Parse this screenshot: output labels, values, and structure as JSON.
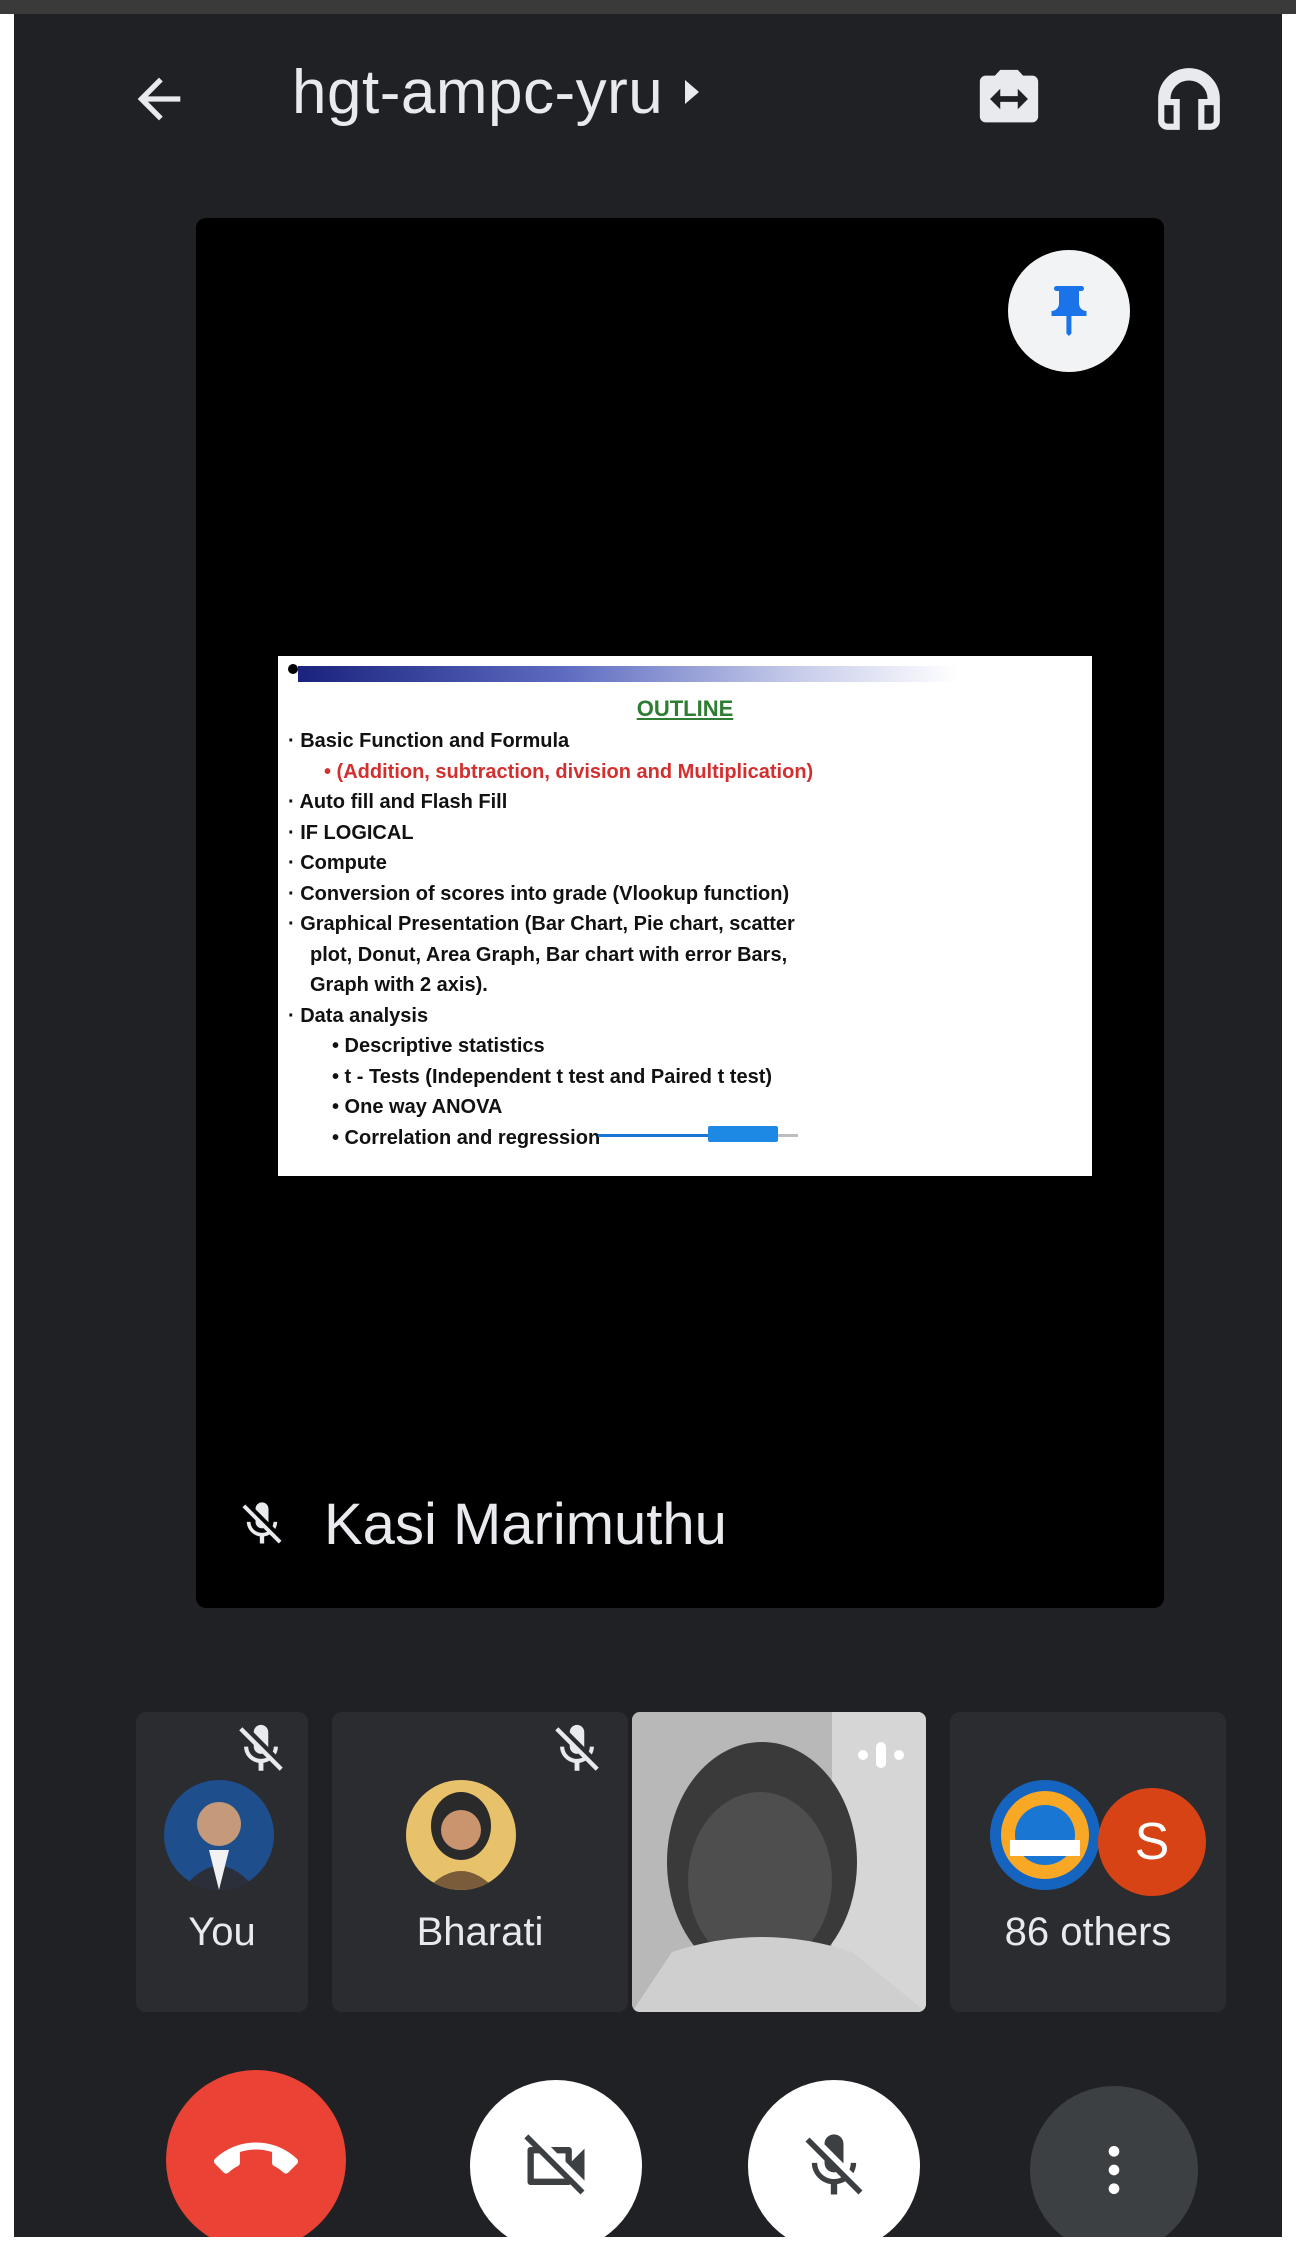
{
  "header": {
    "meeting_code": "hgt-ampc-yru",
    "back_icon": "arrow-left-icon",
    "switch_camera_icon": "camera-switch-icon",
    "audio_icon": "headphones-icon"
  },
  "main_tile": {
    "pin_icon": "pin-icon",
    "speaker_name": "Kasi Marimuthu",
    "speaker_muted_icon": "mic-off-icon",
    "slide": {
      "title": "OUTLINE",
      "lines": [
        "· Basic Function and Formula",
        "• (Addition, subtraction, division and Multiplication)",
        "· Auto fill and Flash Fill",
        "· IF LOGICAL",
        "· Compute",
        "· Conversion of scores into grade (Vlookup function)",
        "· Graphical Presentation (Bar Chart, Pie chart, scatter",
        "plot, Donut, Area Graph, Bar chart with error Bars,",
        "Graph with 2 axis).",
        "· Data analysis",
        "• Descriptive statistics",
        "• t - Tests (Independent t test and Paired t test)",
        "• One way ANOVA",
        "• Correlation and regression"
      ]
    }
  },
  "participants": [
    {
      "name": "You",
      "muted": true
    },
    {
      "name": "Bharati",
      "muted": true
    },
    {
      "name": "",
      "video": true
    },
    {
      "name": "86 others",
      "badge": "S"
    }
  ],
  "controls": {
    "end_call_icon": "phone-hangup-icon",
    "camera_icon": "camera-off-icon",
    "mic_icon": "mic-off-icon",
    "more_icon": "more-vert-icon"
  },
  "colors": {
    "background": "#202124",
    "end_call": "#ea4335",
    "badge": "#d84315"
  }
}
